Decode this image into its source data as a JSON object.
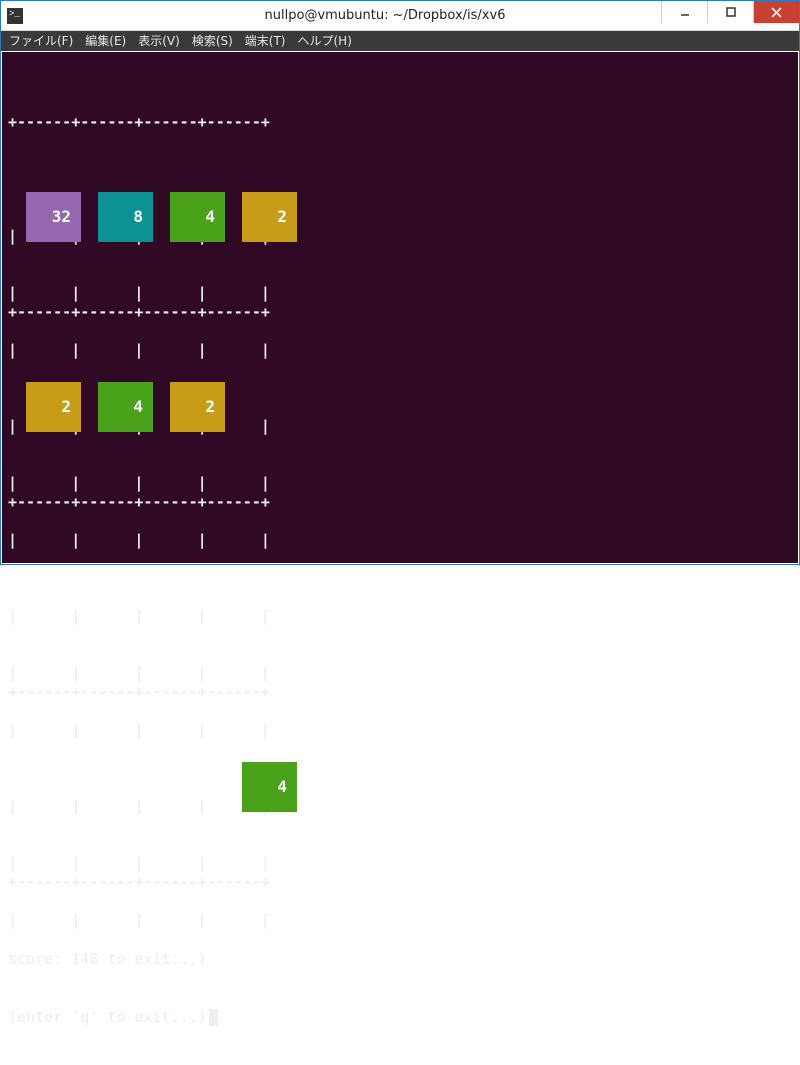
{
  "window": {
    "title": "nullpo@vmubuntu: ~/Dropbox/is/xv6"
  },
  "menubar": {
    "items": [
      "ファイル(F)",
      "編集(E)",
      "表示(V)",
      "検索(S)",
      "端末(T)",
      "ヘルプ(H)"
    ]
  },
  "game": {
    "score_line": "score: 148 to exit...)",
    "hint_line": "(enter 'q' to exit...)",
    "grid_border": "+------+------+------+------+",
    "pipe_row": "|      |      |      |      |",
    "board": [
      [
        32,
        8,
        4,
        2
      ],
      [
        2,
        4,
        2,
        null
      ],
      [
        null,
        null,
        null,
        null
      ],
      [
        null,
        null,
        null,
        4
      ]
    ],
    "tile_colors": {
      "2": "#c79c18",
      "4": "#4aa21a",
      "8": "#0d9294",
      "32": "#9467b0"
    }
  }
}
